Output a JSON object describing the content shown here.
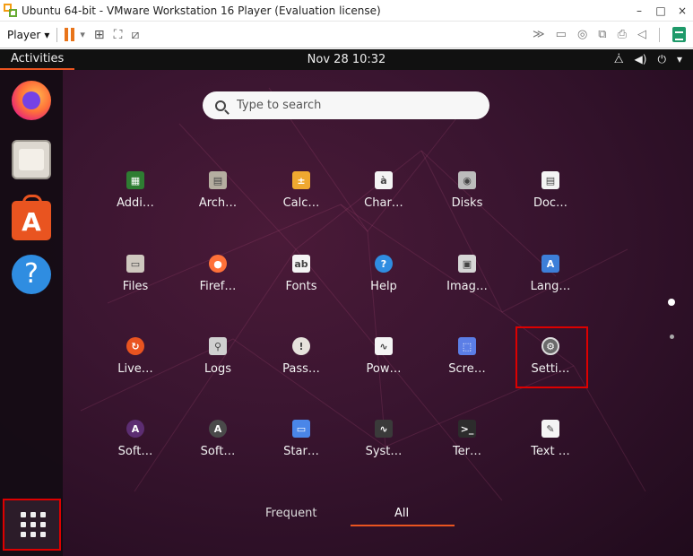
{
  "window": {
    "title": "Ubuntu 64-bit - VMware Workstation 16 Player (Evaluation license)",
    "minimize": "–",
    "maximize": "□",
    "close": "×"
  },
  "toolbar": {
    "player_label": "Player",
    "player_caret": "▾",
    "pause_caret": "▾"
  },
  "topbar": {
    "activities": "Activities",
    "clock": "Nov 28  10:32"
  },
  "search": {
    "placeholder": "Type to search"
  },
  "apps": [
    {
      "label": "Addi…",
      "icon": "circuit-icon",
      "color": "#2e7d32",
      "glyph": "▦"
    },
    {
      "label": "Arch…",
      "icon": "archive-icon",
      "color": "#b5aea0",
      "glyph": "▤"
    },
    {
      "label": "Calc…",
      "icon": "calculator-icon",
      "color": "#f0a830",
      "glyph": "±"
    },
    {
      "label": "Char…",
      "icon": "characters-icon",
      "color": "#f4f4f4",
      "glyph": "à"
    },
    {
      "label": "Disks",
      "icon": "disks-icon",
      "color": "#bcbcbc",
      "glyph": "◉"
    },
    {
      "label": "Doc…",
      "icon": "document-viewer-icon",
      "color": "#f4f4f4",
      "glyph": "▤"
    },
    {
      "label": "Files",
      "icon": "files-icon",
      "color": "#cfc8bf",
      "glyph": "▭"
    },
    {
      "label": "Firef…",
      "icon": "firefox-icon",
      "color": "#ff7139",
      "glyph": "●"
    },
    {
      "label": "Fonts",
      "icon": "fonts-icon",
      "color": "#f4f4f4",
      "glyph": "ab"
    },
    {
      "label": "Help",
      "icon": "help-icon",
      "color": "#2f8de1",
      "glyph": "?"
    },
    {
      "label": "Imag…",
      "icon": "image-viewer-icon",
      "color": "#d6d6d6",
      "glyph": "▣"
    },
    {
      "label": "Lang…",
      "icon": "language-icon",
      "color": "#3d7fd9",
      "glyph": "A"
    },
    {
      "label": "Live…",
      "icon": "livepatch-icon",
      "color": "#e95420",
      "glyph": "↻"
    },
    {
      "label": "Logs",
      "icon": "logs-icon",
      "color": "#d0d0d0",
      "glyph": "⚲"
    },
    {
      "label": "Pass…",
      "icon": "passwords-icon",
      "color": "#e6e2dc",
      "glyph": "!"
    },
    {
      "label": "Pow…",
      "icon": "power-statistics-icon",
      "color": "#f4f4f4",
      "glyph": "∿"
    },
    {
      "label": "Scre…",
      "icon": "screenshot-icon",
      "color": "#5b7ee6",
      "glyph": "⬚"
    },
    {
      "label": "Setti…",
      "icon": "settings-icon",
      "color": "#6b6b6b",
      "glyph": "⚙"
    },
    {
      "label": "Soft…",
      "icon": "software-updater-icon",
      "color": "#5c2d72",
      "glyph": "A"
    },
    {
      "label": "Soft…",
      "icon": "software-properties-icon",
      "color": "#4a4a4a",
      "glyph": "A"
    },
    {
      "label": "Star…",
      "icon": "startup-disk-icon",
      "color": "#4a86e8",
      "glyph": "▭"
    },
    {
      "label": "Syst…",
      "icon": "system-monitor-icon",
      "color": "#3a3a3a",
      "glyph": "∿"
    },
    {
      "label": "Ter…",
      "icon": "terminal-icon",
      "color": "#2c2c2c",
      "glyph": ">_"
    },
    {
      "label": "Text …",
      "icon": "text-editor-icon",
      "color": "#f4f4f4",
      "glyph": "✎"
    }
  ],
  "tabs": {
    "frequent": "Frequent",
    "all": "All"
  },
  "dock": {
    "help_glyph": "?",
    "store_glyph": "A"
  }
}
